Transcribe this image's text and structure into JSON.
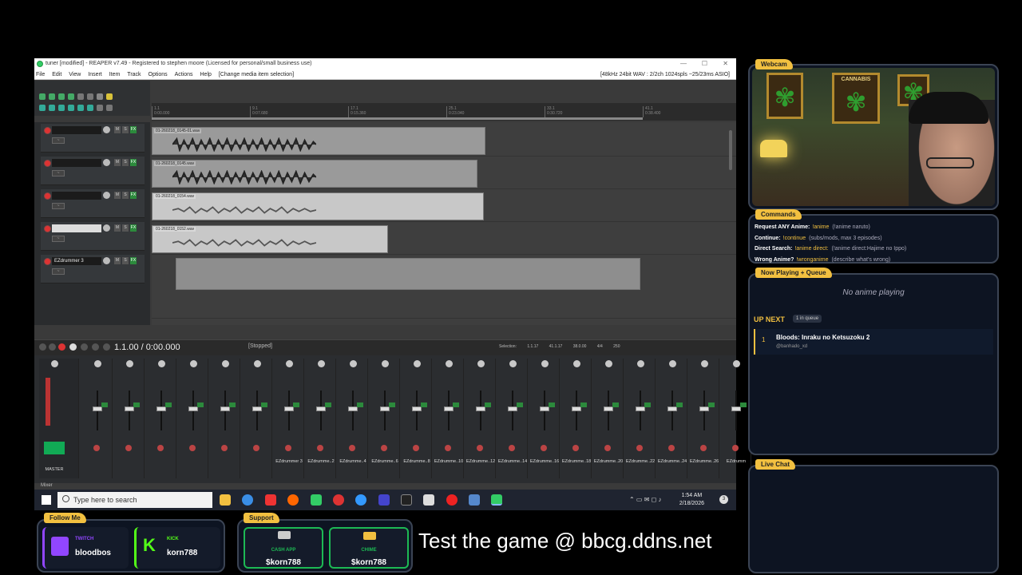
{
  "reaper": {
    "title": "tuner [modified] - REAPER v7.49 - Registered to stephen moore (Licensed for personal/small business use)",
    "menu": [
      "File",
      "Edit",
      "View",
      "Insert",
      "Item",
      "Track",
      "Options",
      "Actions",
      "Help",
      "[Change media item selection]"
    ],
    "audio_status": "[48kHz 24bit WAV : 2/2ch 1024spls ~25/23ms ASIO]",
    "ruler": [
      {
        "bar": "1.1",
        "time": "0:00.000"
      },
      {
        "bar": "9.1",
        "time": "0:07.680"
      },
      {
        "bar": "17.1",
        "time": "0:15.360"
      },
      {
        "bar": "25.1",
        "time": "0:23.040"
      },
      {
        "bar": "33.1",
        "time": "0:30.720"
      },
      {
        "bar": "41.1",
        "time": "0:38.400"
      }
    ],
    "tracks": [
      {
        "name": "",
        "item": "01-260218_0145-01.wav"
      },
      {
        "name": "",
        "item": "01-260218_0145.wav"
      },
      {
        "name": "",
        "item": "01-260218_0154.wav"
      },
      {
        "name": "",
        "item": "01-260218_0152.wav"
      },
      {
        "name": "EZdrummer 3",
        "item": ""
      }
    ],
    "transport": {
      "position": "1.1.00 / 0:00.000",
      "status": "[Stopped]",
      "selection_label": "Selection:",
      "sel_start": "1.1.17",
      "sel_end": "41.1.17",
      "sel_len": "38.0.00",
      "time_sig": "4/4",
      "bpm": "250"
    },
    "mixer": {
      "master_label": "MASTER",
      "tab": "Mixer",
      "strips": [
        "",
        "",
        "",
        "",
        "",
        "",
        "EZdrummer 3",
        "EZdrumme..2",
        "EZdrumme..4",
        "EZdrumme..6",
        "EZdrumme..8",
        "EZdrumme..10",
        "EZdrumme..12",
        "EZdrumme..14",
        "EZdrumme..16",
        "EZdrumme..18",
        "EZdrumme..20",
        "EZdrumme..22",
        "EZdrumme..24",
        "EZdrumme..26",
        "EZdrumm"
      ]
    }
  },
  "taskbar": {
    "search_placeholder": "Type here to search",
    "time": "1:54 AM",
    "date": "2/18/2026",
    "notifications": "3"
  },
  "overlay": {
    "webcam_label": "Webcam",
    "poster_text": "CANNABIS",
    "commands_label": "Commands",
    "commands": [
      {
        "label": "Request ANY Anime:",
        "cmd": "!anime",
        "hint": "(!anime naruto)"
      },
      {
        "label": "Continue:",
        "cmd": "!continue",
        "hint": "(subs/mods, max 3 episodes)"
      },
      {
        "label": "Direct Search:",
        "cmd": "!anime direct:",
        "hint": "(!anime direct:Hajime no Ippo)"
      },
      {
        "label": "Wrong Anime?",
        "cmd": "!wronganime",
        "hint": "(describe what's wrong)"
      }
    ],
    "queue_label": "Now Playing + Queue",
    "now_playing": "No anime playing",
    "up_next": "UP NEXT",
    "queue_count": "1 in queue",
    "queue_items": [
      {
        "num": "1",
        "title": "Bloods: Inraku no Ketsuzoku 2",
        "user": "@banhado_xd"
      }
    ],
    "chat_label": "Live Chat",
    "follow_label": "Follow Me",
    "twitch_label": "TWITCH",
    "twitch_user": "bloodbos",
    "kick_label": "KICK",
    "kick_user": "korn788",
    "support_label": "Support",
    "cashapp_label": "CASH APP",
    "cashapp_user": "$korn788",
    "chime_label": "CHIME",
    "chime_user": "$korn788",
    "promo": "Test the game @ bbcg.ddns.net"
  },
  "colors": {
    "accent": "#f2c040",
    "twitch": "#9146ff",
    "kick": "#53fc18",
    "cash": "#1db954",
    "record": "#d33333",
    "fx": "#2c8a3c"
  }
}
